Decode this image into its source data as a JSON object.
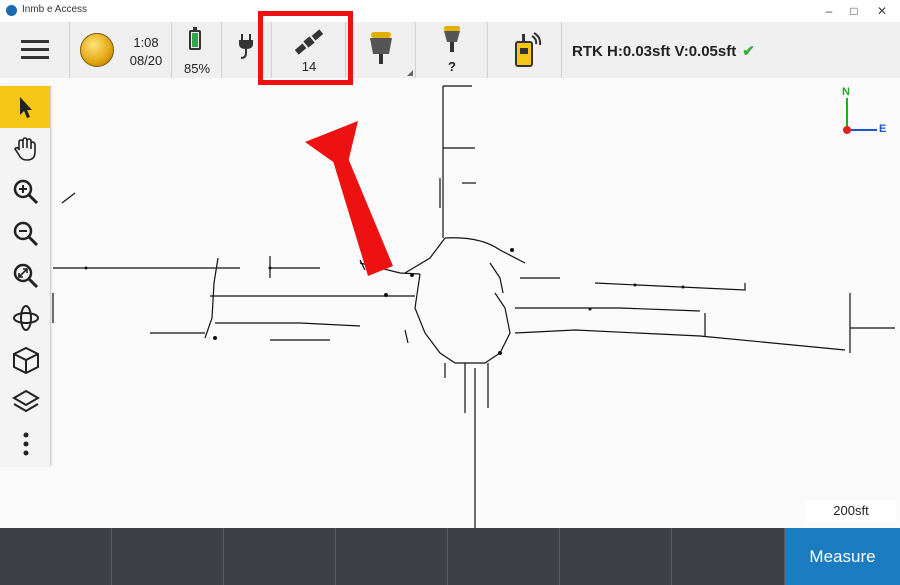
{
  "window": {
    "title": "Inmb e Access",
    "minimize": "–",
    "maximize": "□",
    "close": "✕"
  },
  "status_bar": {
    "time": "1:08",
    "date": "08/20",
    "battery_percent": "85%",
    "battery_level": 0.85,
    "satellites": "14",
    "receiver_status": "?",
    "rtk_status": "RTK H:0.03sft V:0.05sft",
    "accent": "#ee1111"
  },
  "map": {
    "compass_north": "N",
    "compass_east": "E",
    "scale": "200sft"
  },
  "side_toolbar": {
    "tools": [
      "select-arrow-icon",
      "pan-hand-icon",
      "zoom-in-icon",
      "zoom-out-icon",
      "zoom-extents-icon",
      "orbit-icon",
      "3d-cube-icon",
      "layers-icon",
      "more-vertical-icon"
    ]
  },
  "bottom_bar": {
    "measure_label": "Measure",
    "accent": "#1b7cc1"
  }
}
